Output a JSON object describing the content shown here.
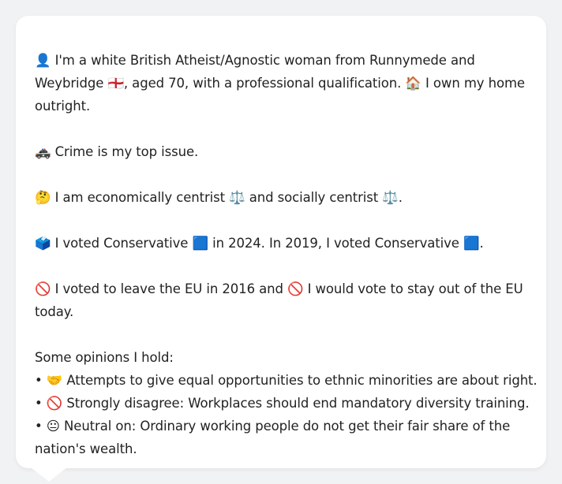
{
  "profile": {
    "identity": "👤 I'm a white British Atheist/Agnostic woman from Runnymede and Weybridge 🏴󠁧󠁢󠁥󠁮󠁧󠁿, aged 70, with a professional qualification. 🏠 I own my home outright.",
    "top_issue": "🚓 Crime is my top issue.",
    "politics": "🤔 I am economically centrist ⚖️ and socially centrist ⚖️.",
    "votes": "🗳️ I voted Conservative 🟦 in 2024. In 2019, I voted Conservative 🟦.",
    "eu": "🚫 I voted to leave the EU in 2016 and 🚫 I would vote to stay out of the EU today."
  },
  "opinions": {
    "heading": "Some opinions I hold:",
    "items": [
      "• 🤝 Attempts to give equal opportunities to ethnic minorities are about right.",
      "• 🚫 Strongly disagree: Workplaces should end mandatory diversity training.",
      "• 😐 Neutral on: Ordinary working people do not get their fair share of the nation's wealth."
    ]
  }
}
